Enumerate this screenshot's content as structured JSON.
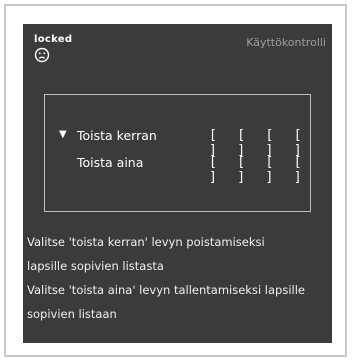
{
  "status": {
    "label": "locked",
    "icon": "sad-face-icon"
  },
  "header": {
    "title": "Käyttökontrolli"
  },
  "options": [
    {
      "label": "Toista kerran",
      "selected": true,
      "slots": [
        "[ ]",
        "[ ]",
        "[ ]",
        "[ ]"
      ]
    },
    {
      "label": "Toista aina",
      "selected": false,
      "slots": [
        "[ ]",
        "[ ]",
        "[ ]",
        "[ ]"
      ]
    }
  ],
  "selection_marker": "▼",
  "help": {
    "line1": "Valitse 'toista kerran' levyn poistamiseksi",
    "line2": "lapsille sopivien listasta",
    "line3": "Valitse 'toista aina' levyn tallentamiseksi lapsille",
    "line4": "sopivien listaan"
  },
  "colors": {
    "panel_background": "#3b3b3b",
    "text": "#ffffff",
    "title_text": "#9e9e9e",
    "box_border": "#bdbdbd"
  }
}
